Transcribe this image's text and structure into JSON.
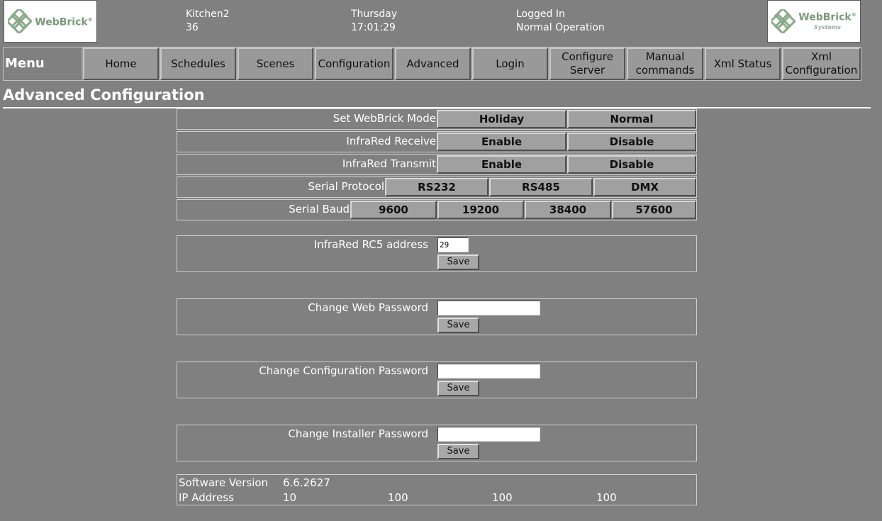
{
  "header": {
    "logo_left": {
      "brand": "WebBrick",
      "sub": ""
    },
    "logo_right": {
      "brand": "WebBrick",
      "sub": "Systems"
    },
    "device_name": "Kitchen2",
    "device_number": "36",
    "day": "Thursday",
    "time": "17:01:29",
    "login_status": "Logged In",
    "operation_status": "Normal Operation"
  },
  "nav": {
    "menu_label": "Menu",
    "items": [
      {
        "label": "Home"
      },
      {
        "label": "Schedules"
      },
      {
        "label": "Scenes"
      },
      {
        "label": "Configuration"
      },
      {
        "label": "Advanced"
      },
      {
        "label": "Login"
      },
      {
        "label": "Configure Server"
      },
      {
        "label": "Manual commands"
      },
      {
        "label": "Xml Status"
      },
      {
        "label": "Xml Configuration"
      }
    ]
  },
  "page_title": "Advanced Configuration",
  "settings": {
    "mode": {
      "label": "Set WebBrick Mode",
      "options": [
        "Holiday",
        "Normal"
      ]
    },
    "ir_receive": {
      "label": "InfraRed Receive",
      "options": [
        "Enable",
        "Disable"
      ]
    },
    "ir_transmit": {
      "label": "InfraRed Transmit",
      "options": [
        "Enable",
        "Disable"
      ]
    },
    "serial_protocol": {
      "label": "Serial Protocol",
      "options": [
        "RS232",
        "RS485",
        "DMX"
      ]
    },
    "serial_baud": {
      "label": "Serial Baud",
      "options": [
        "9600",
        "19200",
        "38400",
        "57600"
      ]
    }
  },
  "forms": {
    "rc5": {
      "label": "InfraRed RC5 address",
      "value": "29",
      "save": "Save"
    },
    "web_password": {
      "label": "Change Web Password",
      "value": "",
      "save": "Save"
    },
    "config_password": {
      "label": "Change Configuration Password",
      "value": "",
      "save": "Save"
    },
    "installer_password": {
      "label": "Change Installer Password",
      "value": "",
      "save": "Save"
    }
  },
  "info": {
    "software_label": "Software Version",
    "software_version": "6.6.2627",
    "ip_label": "IP Address",
    "ip": [
      "10",
      "100",
      "100",
      "100"
    ]
  },
  "colors": {
    "background": "#808080",
    "button": "#a0a0a0",
    "logo_green": "#7a9a7a"
  }
}
